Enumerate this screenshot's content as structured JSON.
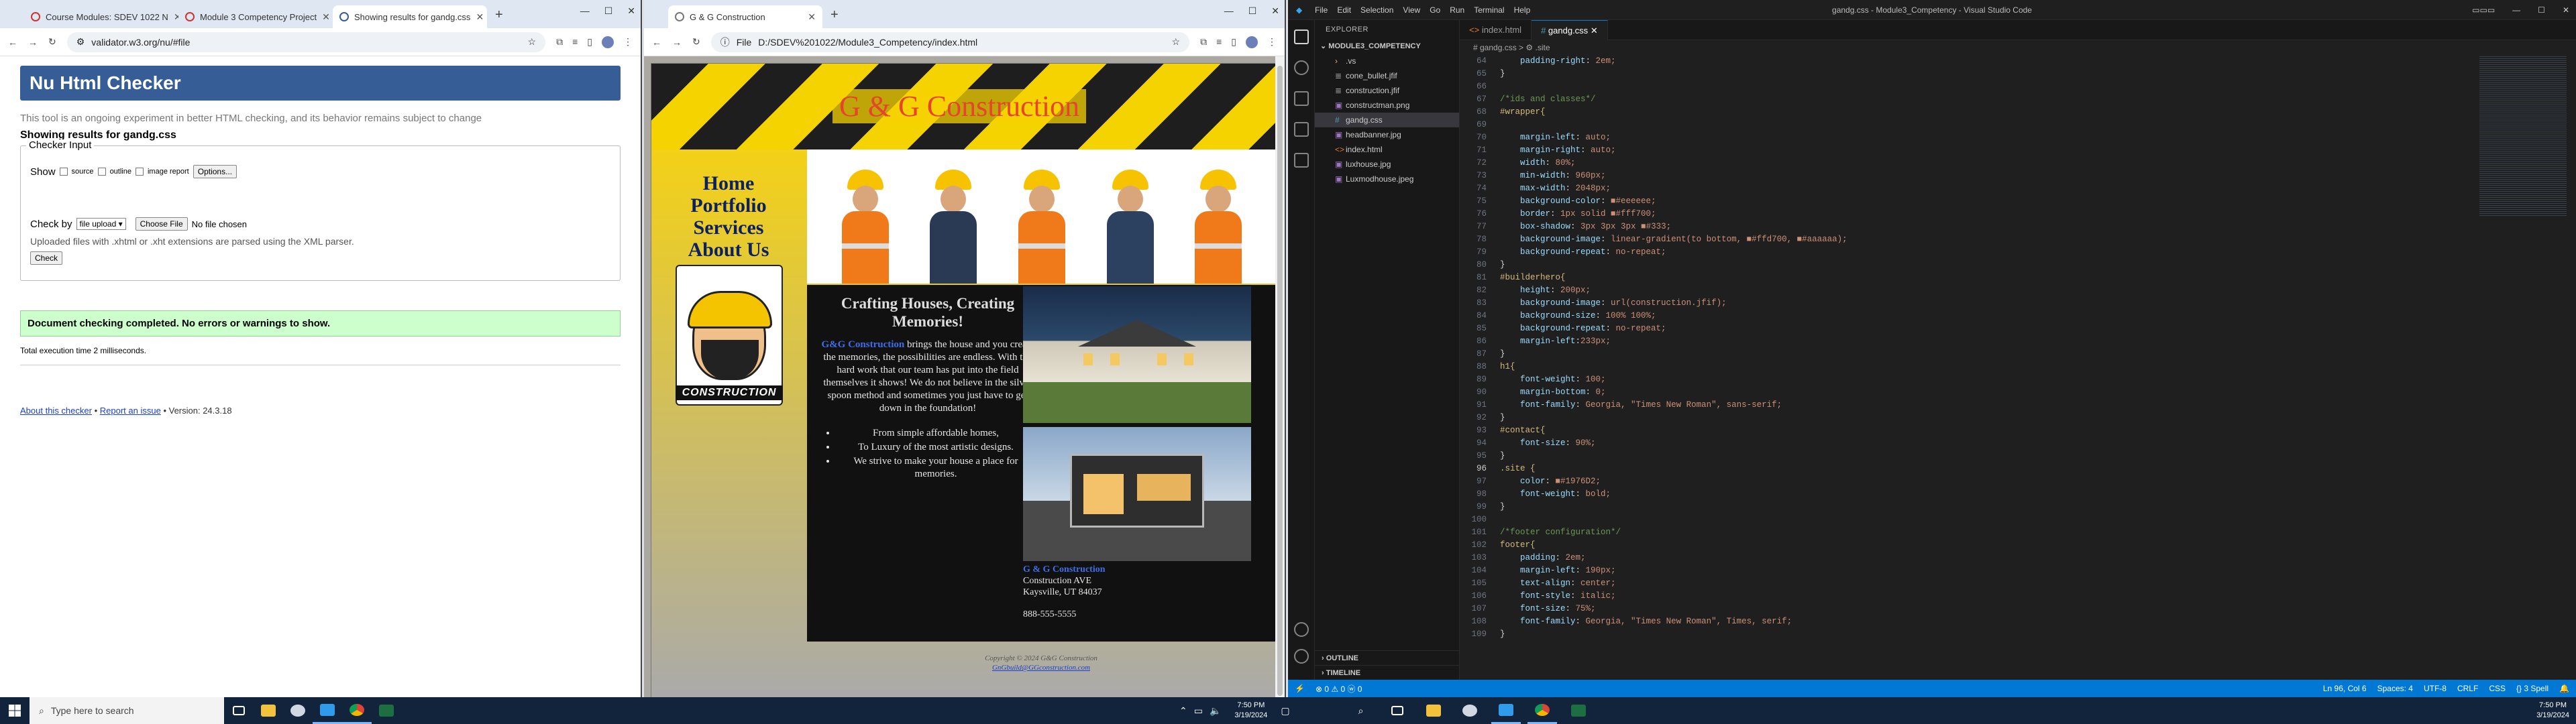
{
  "win1": {
    "tabs": [
      {
        "label": "Course Modules: SDEV 1022 N"
      },
      {
        "label": "Module 3 Competency Project"
      },
      {
        "label": "Showing results for gandg.css"
      }
    ],
    "url": "validator.w3.org/nu/#file",
    "validator": {
      "title": "Nu Html Checker",
      "note": "This tool is an ongoing experiment in better HTML checking, and its behavior remains subject to change",
      "results_heading": "Showing results for gandg.css",
      "input_legend": "Checker Input",
      "show_label": "Show",
      "opt_source": "source",
      "opt_outline": "outline",
      "opt_report": "image report",
      "options_btn": "Options...",
      "checkby_label": "Check by",
      "checkby_value": "file upload",
      "choose_btn": "Choose File",
      "no_file": "No file chosen",
      "upload_note": "Uploaded files with .xhtml or .xht extensions are parsed using the XML parser.",
      "check_btn": "Check",
      "success": "Document checking completed. No errors or warnings to show.",
      "exec_time": "Total execution time 2 milliseconds.",
      "about_link": "About this checker",
      "sep1": "•",
      "issue_link": "Report an issue",
      "version": "• Version: 24.3.18"
    }
  },
  "win2": {
    "tab": "G & G Construction",
    "url_label": "File",
    "url": "D:/SDEV%201022/Module3_Competency/index.html",
    "site": {
      "title": "G & G Construction",
      "nav": [
        "Home",
        "Portfolio",
        "Services",
        "About Us"
      ],
      "logo_word": "CONSTRUCTION",
      "heading": "Crafting Houses, Creating Memories!",
      "brand": "G&G Construction",
      "body": "brings the house and you create the memories, the possibilities are endless. With the hard work that our team has put into the field themselves it shows! We do not believe in the silver spoon method and sometimes you just have to get down in the foundation!",
      "bullets": [
        "From simple affordable homes,",
        "To Luxury of the most artistic designs.",
        "We strive to make your house a place for memories."
      ],
      "contact_name": "G & G Construction",
      "contact_addr1": "Construction AVE",
      "contact_addr2": "Kaysville, UT 84037",
      "contact_phone": "888-555-5555",
      "footer_copy": "Copyright © 2024 G&G Construction",
      "footer_mail": "GnGbuild@GGconstruction.com"
    }
  },
  "vscode": {
    "menu": [
      "File",
      "Edit",
      "Selection",
      "View",
      "Go",
      "Run",
      "Terminal",
      "Help"
    ],
    "title": "gandg.css - Module3_Competency - Visual Studio Code",
    "explorer_title": "EXPLORER",
    "folder": "MODULE3_COMPETENCY",
    "files": [
      ".vs",
      "cone_bullet.jfif",
      "construction.jfif",
      "constructman.png",
      "gandg.css",
      "headbanner.jpg",
      "index.html",
      "luxhouse.jpg",
      "Luxmodhouse.jpeg"
    ],
    "tabs": [
      "index.html",
      "gandg.css"
    ],
    "breadcrumb": "# gandg.css > ⚙ .site",
    "outline": "OUTLINE",
    "timeline": "TIMELINE",
    "status_left": "⊗ 0 ⚠ 0   ⓦ 0",
    "status_right": [
      "Ln 96, Col 6",
      "Spaces: 4",
      "UTF-8",
      "CRLF",
      "CSS",
      "{} 3 Spell",
      "🔔"
    ],
    "code": [
      {
        "n": "64",
        "t": "    padding-right: 2em;"
      },
      {
        "n": "65",
        "t": "}"
      },
      {
        "n": "66",
        "t": ""
      },
      {
        "n": "67",
        "t": "/*ids and classes*/"
      },
      {
        "n": "68",
        "t": "#wrapper{"
      },
      {
        "n": "69",
        "t": ""
      },
      {
        "n": "70",
        "t": "    margin-left: auto;"
      },
      {
        "n": "71",
        "t": "    margin-right: auto;"
      },
      {
        "n": "72",
        "t": "    width: 80%;"
      },
      {
        "n": "73",
        "t": "    min-width: 960px;"
      },
      {
        "n": "74",
        "t": "    max-width: 2048px;"
      },
      {
        "n": "75",
        "t": "    background-color: ■#eeeeee;"
      },
      {
        "n": "76",
        "t": "    border: 1px solid ■#fff700;"
      },
      {
        "n": "77",
        "t": "    box-shadow: 3px 3px 3px ■#333;"
      },
      {
        "n": "78",
        "t": "    background-image: linear-gradient(to bottom, ■#ffd700, ■#aaaaaa);"
      },
      {
        "n": "79",
        "t": "    background-repeat: no-repeat;"
      },
      {
        "n": "80",
        "t": "}"
      },
      {
        "n": "81",
        "t": "#builderhero{"
      },
      {
        "n": "82",
        "t": "    height: 200px;"
      },
      {
        "n": "83",
        "t": "    background-image: url(construction.jfif);"
      },
      {
        "n": "84",
        "t": "    background-size: 100% 100%;"
      },
      {
        "n": "85",
        "t": "    background-repeat: no-repeat;"
      },
      {
        "n": "86",
        "t": "    margin-left:233px;"
      },
      {
        "n": "87",
        "t": "}"
      },
      {
        "n": "88",
        "t": "h1{"
      },
      {
        "n": "89",
        "t": "    font-weight: 100;"
      },
      {
        "n": "90",
        "t": "    margin-bottom: 0;"
      },
      {
        "n": "91",
        "t": "    font-family: Georgia, \"Times New Roman\", sans-serif;"
      },
      {
        "n": "92",
        "t": "}"
      },
      {
        "n": "93",
        "t": "#contact{"
      },
      {
        "n": "94",
        "t": "    font-size: 90%;"
      },
      {
        "n": "95",
        "t": "}"
      },
      {
        "n": "96",
        "t": ".site {"
      },
      {
        "n": "97",
        "t": "    color: ■#1976D2;"
      },
      {
        "n": "98",
        "t": "    font-weight: bold;"
      },
      {
        "n": "99",
        "t": "}"
      },
      {
        "n": "100",
        "t": ""
      },
      {
        "n": "101",
        "t": "/*footer configuration*/"
      },
      {
        "n": "102",
        "t": "footer{"
      },
      {
        "n": "103",
        "t": "    padding: 2em;"
      },
      {
        "n": "104",
        "t": "    margin-left: 190px;"
      },
      {
        "n": "105",
        "t": "    text-align: center;"
      },
      {
        "n": "106",
        "t": "    font-style: italic;"
      },
      {
        "n": "107",
        "t": "    font-size: 75%;"
      },
      {
        "n": "108",
        "t": "    font-family: Georgia, \"Times New Roman\", Times, serif;"
      },
      {
        "n": "109",
        "t": "}"
      }
    ]
  },
  "taskbar": {
    "search_placeholder": "Type here to search",
    "time_left": "7:50 PM",
    "date_left": "3/19/2024",
    "time_right": "7:50 PM",
    "date_right": "3/19/2024"
  }
}
